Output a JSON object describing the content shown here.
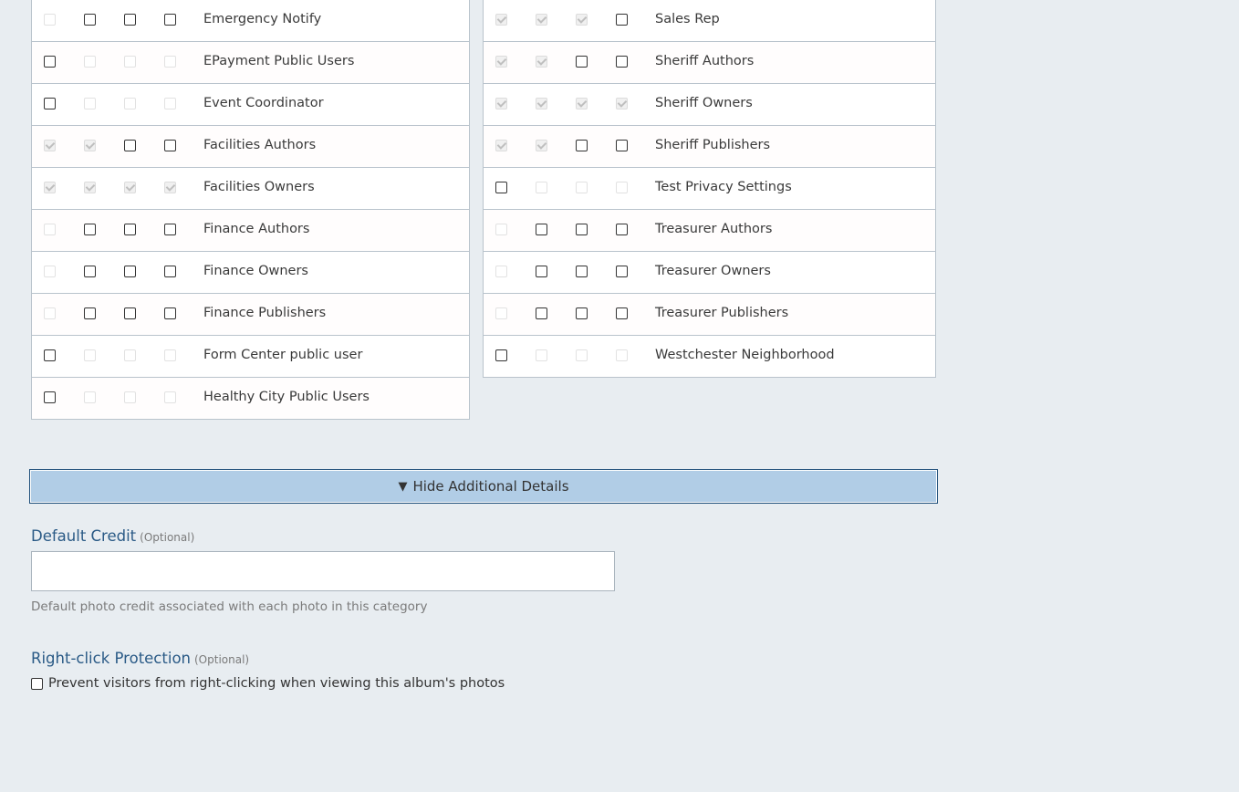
{
  "groups_left": [
    {
      "name": "Emergency Notify",
      "boxes": [
        {
          "checked": false,
          "disabled": true
        },
        {
          "checked": false,
          "disabled": false
        },
        {
          "checked": false,
          "disabled": false
        },
        {
          "checked": false,
          "disabled": false
        }
      ]
    },
    {
      "name": "EPayment Public Users",
      "boxes": [
        {
          "checked": false,
          "disabled": false
        },
        {
          "checked": false,
          "disabled": true
        },
        {
          "checked": false,
          "disabled": true
        },
        {
          "checked": false,
          "disabled": true
        }
      ]
    },
    {
      "name": "Event Coordinator",
      "boxes": [
        {
          "checked": false,
          "disabled": false
        },
        {
          "checked": false,
          "disabled": true
        },
        {
          "checked": false,
          "disabled": true
        },
        {
          "checked": false,
          "disabled": true
        }
      ]
    },
    {
      "name": "Facilities Authors",
      "boxes": [
        {
          "checked": true,
          "disabled": true
        },
        {
          "checked": true,
          "disabled": true
        },
        {
          "checked": false,
          "disabled": false
        },
        {
          "checked": false,
          "disabled": false
        }
      ]
    },
    {
      "name": "Facilities Owners",
      "boxes": [
        {
          "checked": true,
          "disabled": true
        },
        {
          "checked": true,
          "disabled": true
        },
        {
          "checked": true,
          "disabled": true
        },
        {
          "checked": true,
          "disabled": true
        }
      ]
    },
    {
      "name": "Finance Authors",
      "boxes": [
        {
          "checked": false,
          "disabled": true
        },
        {
          "checked": false,
          "disabled": false
        },
        {
          "checked": false,
          "disabled": false
        },
        {
          "checked": false,
          "disabled": false
        }
      ]
    },
    {
      "name": "Finance Owners",
      "boxes": [
        {
          "checked": false,
          "disabled": true
        },
        {
          "checked": false,
          "disabled": false
        },
        {
          "checked": false,
          "disabled": false
        },
        {
          "checked": false,
          "disabled": false
        }
      ]
    },
    {
      "name": "Finance Publishers",
      "boxes": [
        {
          "checked": false,
          "disabled": true
        },
        {
          "checked": false,
          "disabled": false
        },
        {
          "checked": false,
          "disabled": false
        },
        {
          "checked": false,
          "disabled": false
        }
      ]
    },
    {
      "name": "Form Center public user",
      "boxes": [
        {
          "checked": false,
          "disabled": false
        },
        {
          "checked": false,
          "disabled": true
        },
        {
          "checked": false,
          "disabled": true
        },
        {
          "checked": false,
          "disabled": true
        }
      ]
    },
    {
      "name": "Healthy City Public Users",
      "boxes": [
        {
          "checked": false,
          "disabled": false
        },
        {
          "checked": false,
          "disabled": true
        },
        {
          "checked": false,
          "disabled": true
        },
        {
          "checked": false,
          "disabled": true
        }
      ]
    }
  ],
  "groups_right": [
    {
      "name": "Sales Rep",
      "boxes": [
        {
          "checked": true,
          "disabled": true
        },
        {
          "checked": true,
          "disabled": true
        },
        {
          "checked": true,
          "disabled": true
        },
        {
          "checked": false,
          "disabled": false
        }
      ]
    },
    {
      "name": "Sheriff Authors",
      "boxes": [
        {
          "checked": true,
          "disabled": true
        },
        {
          "checked": true,
          "disabled": true
        },
        {
          "checked": false,
          "disabled": false
        },
        {
          "checked": false,
          "disabled": false
        }
      ]
    },
    {
      "name": "Sheriff Owners",
      "boxes": [
        {
          "checked": true,
          "disabled": true
        },
        {
          "checked": true,
          "disabled": true
        },
        {
          "checked": true,
          "disabled": true
        },
        {
          "checked": true,
          "disabled": true
        }
      ]
    },
    {
      "name": "Sheriff Publishers",
      "boxes": [
        {
          "checked": true,
          "disabled": true
        },
        {
          "checked": true,
          "disabled": true
        },
        {
          "checked": false,
          "disabled": false
        },
        {
          "checked": false,
          "disabled": false
        }
      ]
    },
    {
      "name": "Test Privacy Settings",
      "boxes": [
        {
          "checked": false,
          "disabled": false
        },
        {
          "checked": false,
          "disabled": true
        },
        {
          "checked": false,
          "disabled": true
        },
        {
          "checked": false,
          "disabled": true
        }
      ]
    },
    {
      "name": "Treasurer Authors",
      "boxes": [
        {
          "checked": false,
          "disabled": true
        },
        {
          "checked": false,
          "disabled": false
        },
        {
          "checked": false,
          "disabled": false
        },
        {
          "checked": false,
          "disabled": false
        }
      ]
    },
    {
      "name": "Treasurer Owners",
      "boxes": [
        {
          "checked": false,
          "disabled": true
        },
        {
          "checked": false,
          "disabled": false
        },
        {
          "checked": false,
          "disabled": false
        },
        {
          "checked": false,
          "disabled": false
        }
      ]
    },
    {
      "name": "Treasurer Publishers",
      "boxes": [
        {
          "checked": false,
          "disabled": true
        },
        {
          "checked": false,
          "disabled": false
        },
        {
          "checked": false,
          "disabled": false
        },
        {
          "checked": false,
          "disabled": false
        }
      ]
    },
    {
      "name": "Westchester Neighborhood",
      "boxes": [
        {
          "checked": false,
          "disabled": false
        },
        {
          "checked": false,
          "disabled": true
        },
        {
          "checked": false,
          "disabled": true
        },
        {
          "checked": false,
          "disabled": true
        }
      ]
    }
  ],
  "toggle": {
    "icon": "triangle-down-icon",
    "label": "Hide Additional Details"
  },
  "default_credit": {
    "label": "Default Credit",
    "optional": "(Optional)",
    "value": "",
    "placeholder": "",
    "help": "Default photo credit associated with each photo in this category"
  },
  "right_click": {
    "label": "Right-click Protection",
    "optional": "(Optional)",
    "checkbox_label": "Prevent visitors from right-clicking when viewing this album's photos",
    "checked": false
  },
  "colors": {
    "accent": "#2a5a86",
    "toggle_bg": "#b1cde6",
    "page_bg": "#e8edf1"
  }
}
